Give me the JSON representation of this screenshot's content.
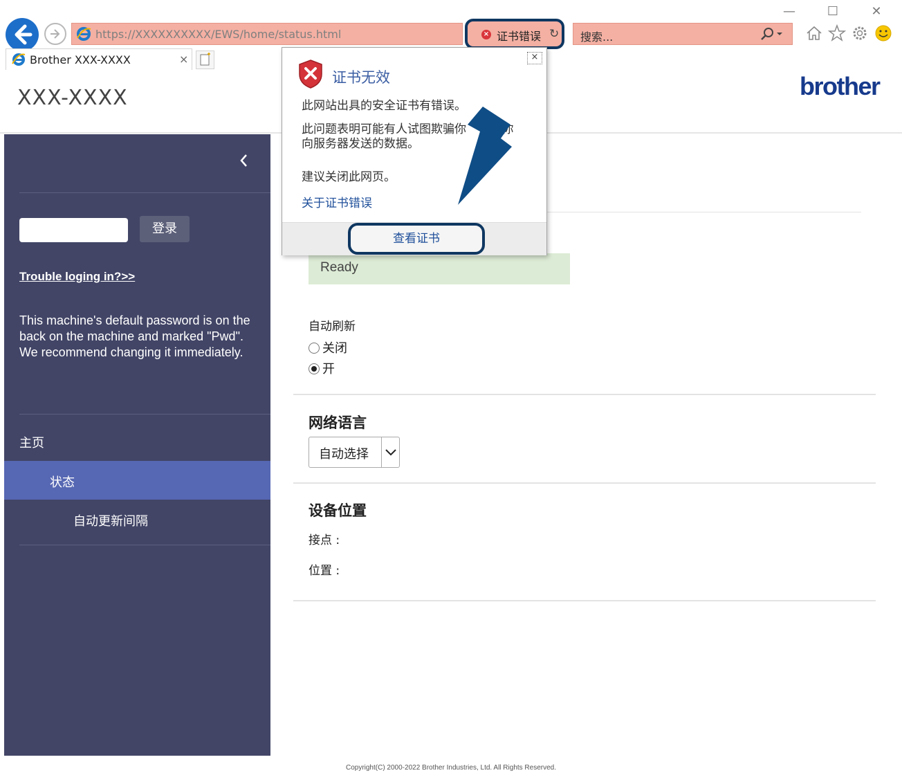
{
  "browser": {
    "url": "https://XXXXXXXXXX/EWS/home/status.html",
    "cert_error_label": "证书错误",
    "search_placeholder": "搜索...",
    "tab_title": "Brother XXX-XXXX",
    "window_controls": [
      "—",
      "☐",
      "✕"
    ],
    "icons": [
      "back-arrow-icon",
      "forward-arrow-icon",
      "ie-icon",
      "refresh-icon",
      "search-icon",
      "home-icon",
      "favorites-star-icon",
      "settings-gear-icon",
      "smiley-feedback-icon",
      "new-tab-icon"
    ]
  },
  "header": {
    "model": "XXX-XXXX",
    "brand": "brother"
  },
  "sidebar": {
    "login_label": "登录",
    "trouble_link": "Trouble loging in?>>",
    "password_note": "This machine's default password is on the back on the machine and marked \"Pwd\".\nWe recommend changing it immediately.",
    "nav": {
      "home": "主页",
      "status": "状态",
      "auto_refresh_interval": "自动更新间隔"
    }
  },
  "main": {
    "status_text": "Ready",
    "auto_refresh": {
      "title": "自动刷新",
      "off": "关闭",
      "on": "开",
      "selected": "开"
    },
    "web_language": {
      "title": "网络语言",
      "value": "自动选择"
    },
    "device_location": {
      "title": "设备位置",
      "contact_label": "接点 :",
      "location_label": "位置 :"
    }
  },
  "popup": {
    "title": "证书无效",
    "line1": "此网站出具的安全证书有错误。",
    "line2a": "此问题表明可能有人试图欺骗你",
    "line2b": ".你",
    "line2c": "向服务器发送的数据。",
    "line3": "建议关闭此网页。",
    "link": "关于证书错误",
    "view_cert": "查看证书"
  },
  "footer": {
    "copyright": "Copyright(C) 2000-2022 Brother Industries, Ltd. All Rights Reserved."
  },
  "colors": {
    "sidebar_bg": "#424566",
    "nav_active": "#5667b3",
    "address_error_bg": "#f4b0a3",
    "highlight_ring": "#0f3761",
    "status_ready_bg": "#dcebd5",
    "brand_blue": "#173a8c"
  }
}
